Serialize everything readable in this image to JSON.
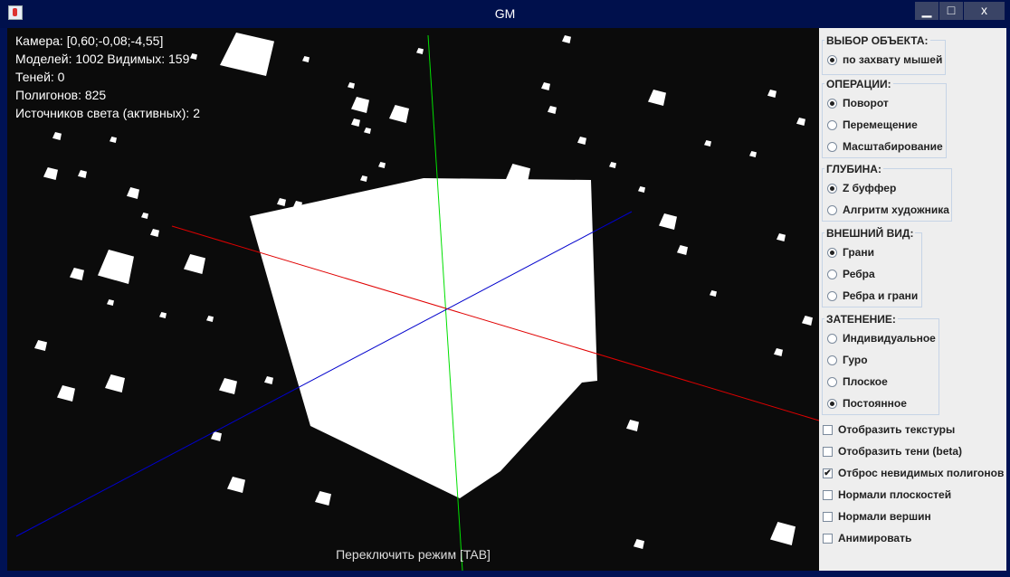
{
  "window": {
    "title": "GM",
    "min_glyph": "▁",
    "max_glyph": "□",
    "close_glyph": "x"
  },
  "hud": {
    "camera": "Камера: [0,60;-0,08;-4,55]",
    "models": "Моделей: 1002  Видимых: 159",
    "shadows": "Теней: 0",
    "polygons": "Полигонов: 825",
    "lights": "Источников света (активных): 2"
  },
  "mode_hint": "Переключить режим [TAB]",
  "colors": {
    "x_axis": "#e00000",
    "y_axis": "#00e000",
    "z_axis": "#0000cc",
    "object": "#ffffff",
    "background": "#0b0b0b"
  },
  "panel": {
    "select": {
      "label": "ВЫБОР ОБЪЕКТА:",
      "options": [
        {
          "label": "по захвату мышей",
          "selected": true
        }
      ]
    },
    "operations": {
      "label": "ОПЕРАЦИИ:",
      "options": [
        {
          "label": "Поворот",
          "selected": true
        },
        {
          "label": "Перемещение",
          "selected": false
        },
        {
          "label": "Масштабирование",
          "selected": false
        }
      ]
    },
    "depth": {
      "label": "ГЛУБИНА:",
      "options": [
        {
          "label": "Z буффер",
          "selected": true
        },
        {
          "label": "Алгритм художника",
          "selected": false
        }
      ]
    },
    "view": {
      "label": "ВНЕШНИЙ ВИД:",
      "options": [
        {
          "label": "Грани",
          "selected": true
        },
        {
          "label": "Ребра",
          "selected": false
        },
        {
          "label": "Ребра и грани",
          "selected": false
        }
      ]
    },
    "shading": {
      "label": "ЗАТЕНЕНИЕ:",
      "options": [
        {
          "label": "Индивидуальное",
          "selected": false
        },
        {
          "label": "Гуро",
          "selected": false
        },
        {
          "label": "Плоское",
          "selected": false
        },
        {
          "label": "Постоянное",
          "selected": true
        }
      ]
    },
    "checkboxes": [
      {
        "label": "Отобразить текстуры",
        "checked": false
      },
      {
        "label": "Отобразить тени (beta)",
        "checked": false
      },
      {
        "label": "Отброс невидимых полигонов",
        "checked": true
      },
      {
        "label": "Нормали плоскостей",
        "checked": false
      },
      {
        "label": "Нормали вершин",
        "checked": false
      },
      {
        "label": "Анимировать",
        "checked": false
      }
    ]
  }
}
